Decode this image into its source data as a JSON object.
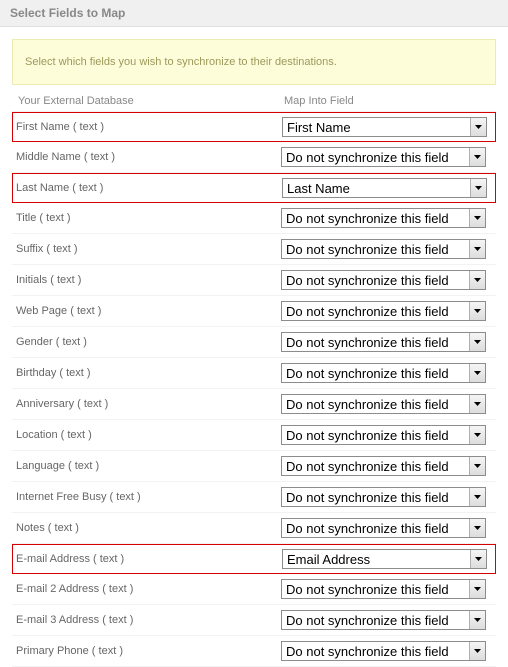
{
  "title": "Select Fields to Map",
  "instruction": "Select which fields you wish to synchronize to their destinations.",
  "headers": {
    "left": "Your External Database",
    "right": "Map Into Field"
  },
  "default_option": "Do not synchronize this field",
  "rows": [
    {
      "label": "First Name ( text )",
      "value": "First Name",
      "highlight": true
    },
    {
      "label": "Middle Name ( text )",
      "value": "Do not synchronize this field",
      "highlight": false
    },
    {
      "label": "Last Name ( text )",
      "value": "Last Name",
      "highlight": true
    },
    {
      "label": "Title ( text )",
      "value": "Do not synchronize this field",
      "highlight": false
    },
    {
      "label": "Suffix ( text )",
      "value": "Do not synchronize this field",
      "highlight": false
    },
    {
      "label": "Initials ( text )",
      "value": "Do not synchronize this field",
      "highlight": false
    },
    {
      "label": "Web Page ( text )",
      "value": "Do not synchronize this field",
      "highlight": false
    },
    {
      "label": "Gender ( text )",
      "value": "Do not synchronize this field",
      "highlight": false
    },
    {
      "label": "Birthday ( text )",
      "value": "Do not synchronize this field",
      "highlight": false
    },
    {
      "label": "Anniversary ( text )",
      "value": "Do not synchronize this field",
      "highlight": false
    },
    {
      "label": "Location ( text )",
      "value": "Do not synchronize this field",
      "highlight": false
    },
    {
      "label": "Language ( text )",
      "value": "Do not synchronize this field",
      "highlight": false
    },
    {
      "label": "Internet Free Busy ( text )",
      "value": "Do not synchronize this field",
      "highlight": false
    },
    {
      "label": "Notes ( text )",
      "value": "Do not synchronize this field",
      "highlight": false
    },
    {
      "label": "E-mail Address ( text )",
      "value": "Email Address",
      "highlight": true
    },
    {
      "label": "E-mail 2 Address ( text )",
      "value": "Do not synchronize this field",
      "highlight": false
    },
    {
      "label": "E-mail 3 Address ( text )",
      "value": "Do not synchronize this field",
      "highlight": false
    },
    {
      "label": "Primary Phone ( text )",
      "value": "Do not synchronize this field",
      "highlight": false
    }
  ]
}
